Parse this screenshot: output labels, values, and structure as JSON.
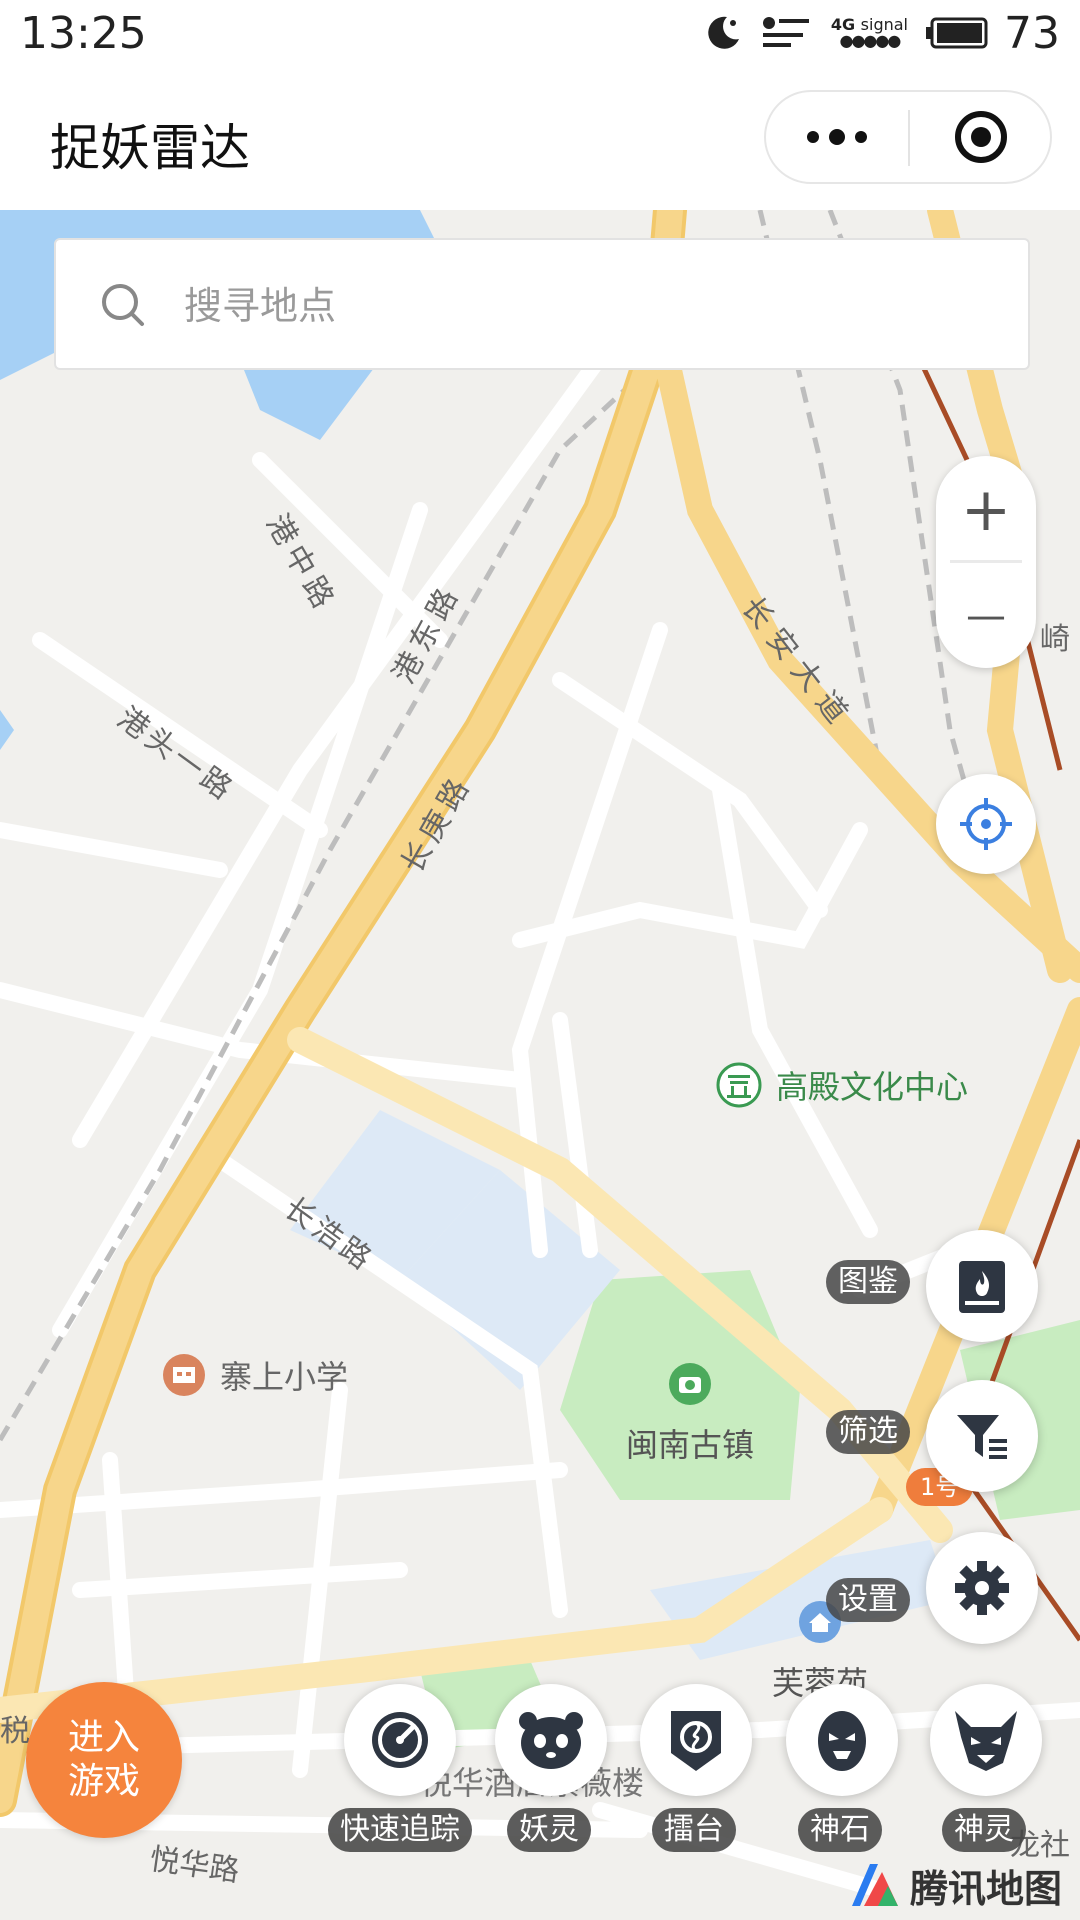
{
  "status_bar": {
    "time": "13:25",
    "network_top": "4G",
    "network_signal": "signal",
    "battery": "73"
  },
  "header": {
    "title": "捉妖雷达",
    "more_icon": "more-dots-icon",
    "close_icon": "target-close-icon"
  },
  "search": {
    "placeholder": "搜寻地点",
    "value": ""
  },
  "map": {
    "roads": [
      "港中路",
      "港东路",
      "港头一路",
      "长庚路",
      "长安大道",
      "长浩路",
      "悦华路"
    ],
    "pois": [
      {
        "name": "高殿文化中心",
        "icon": "culture-icon"
      },
      {
        "name": "寨上小学",
        "icon": "school-icon"
      },
      {
        "name": "闽南古镇",
        "icon": "camera-icon"
      },
      {
        "name": "芙蓉苑",
        "icon": "home-icon"
      },
      {
        "name": "悦华酒店紫薇楼",
        "icon": ""
      }
    ],
    "edge_labels": [
      "崎",
      "税",
      "龙社"
    ],
    "metro_badge": "1号"
  },
  "controls": {
    "zoom_in": "+",
    "zoom_out": "—",
    "locate_icon": "locate-icon"
  },
  "side_actions": [
    {
      "label": "图鉴",
      "icon": "book-icon"
    },
    {
      "label": "筛选",
      "icon": "filter-icon"
    },
    {
      "label": "设置",
      "icon": "gear-icon"
    }
  ],
  "bottom_actions": [
    {
      "label": "快速追踪",
      "icon": "speedometer-icon"
    },
    {
      "label": "妖灵",
      "icon": "panda-icon"
    },
    {
      "label": "擂台",
      "icon": "arena-icon"
    },
    {
      "label": "神石",
      "icon": "stone-icon"
    },
    {
      "label": "神灵",
      "icon": "demon-icon"
    }
  ],
  "enter_game": {
    "line1": "进入",
    "line2": "游戏"
  },
  "brand": {
    "name": "腾讯地图"
  },
  "colors": {
    "accent": "#f5843d",
    "road_major": "#f7d68b",
    "water": "#a6d0f5",
    "park": "#c8ecc0",
    "locate": "#3b7fe0"
  }
}
